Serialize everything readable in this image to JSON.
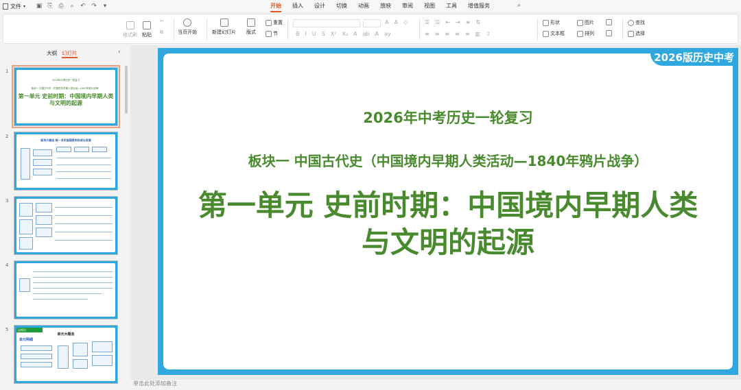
{
  "menubar": {
    "file_label": "文件",
    "tabs": [
      "开始",
      "插入",
      "设计",
      "切换",
      "动画",
      "放映",
      "审阅",
      "视图",
      "工具",
      "增值服务"
    ],
    "active_tab": "开始"
  },
  "toolbar": {
    "format_painter": "格式刷",
    "paste": "粘贴",
    "start_from_current": "当页开始",
    "new_slide": "新建幻灯片",
    "layout": "版式",
    "reset": "重置",
    "section": "节",
    "shape": "形状",
    "picture": "图片",
    "find": "查找",
    "textbox": "文本框",
    "arrange": "排列",
    "select": "选择"
  },
  "left_panel": {
    "tab_outline": "大纲",
    "tab_slides": "幻灯片",
    "active_tab": "幻灯片",
    "thumbnails": [
      {
        "num": "1",
        "line1": "2026年中考历史一轮复习",
        "line2": "板块一 中国古代史（中国境内早期人类活动—1840年鸦片战争）",
        "line3": "第一单元 史前时期：中国境内早期人类与文明的起源"
      },
      {
        "num": "2",
        "title": "板块大概念 统一多民族国家的形成与发展"
      },
      {
        "num": "3"
      },
      {
        "num": "4"
      },
      {
        "num": "5",
        "banner": "过知识",
        "title": "单元大概念",
        "sub": "单元明细"
      }
    ]
  },
  "notes_placeholder": "单击此处添加备注",
  "slide": {
    "brand": "2026版历史中考",
    "line1": "2026年中考历史一轮复习",
    "line2": "板块一  中国古代史（中国境内早期人类活动—1840年鸦片战争）",
    "line3a": "第一单元  史前时期：中国境内早期人类",
    "line3b": "与文明的起源"
  },
  "colors": {
    "accent": "#e0592a",
    "slide_border": "#2ea8df",
    "title_green": "#4a8a2e"
  }
}
